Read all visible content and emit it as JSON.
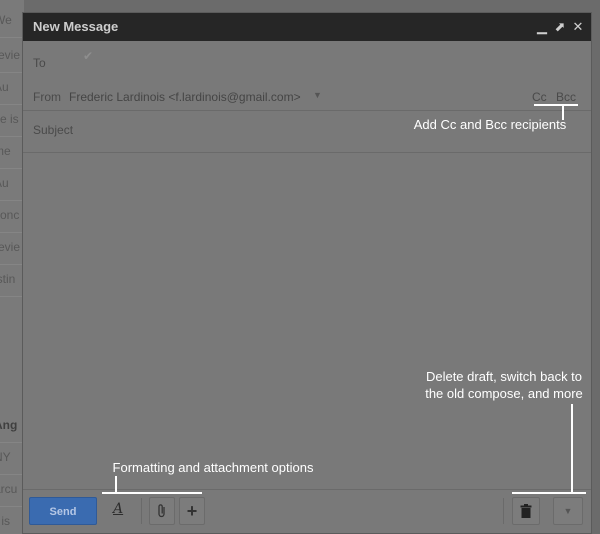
{
  "background_list": {
    "rows": [
      "We",
      "revie",
      "Au",
      "ve is",
      "me",
      "Au",
      "conc",
      "revie",
      "istin",
      "Ang",
      "NY",
      "arcu",
      "r is"
    ]
  },
  "compose": {
    "title": "New Message",
    "window_controls": {
      "minimize": "▁",
      "popout": "⬈",
      "close": "✕"
    },
    "to_label": "To",
    "from_label": "From",
    "from_value": "Frederic Lardinois <f.lardinois@gmail.com>",
    "cc_label": "Cc",
    "bcc_label": "Bcc",
    "subject_label": "Subject",
    "send_label": "Send"
  },
  "callouts": {
    "cc_bcc": "Add Cc and Bcc recipients",
    "more_line1": "Delete draft, switch back to",
    "more_line2": "the old compose, and more",
    "formatting": "Formatting and attachment options"
  },
  "colors": {
    "send_button": "#3a6bb0",
    "titlebar": "#262626",
    "overlay": "#797979"
  }
}
